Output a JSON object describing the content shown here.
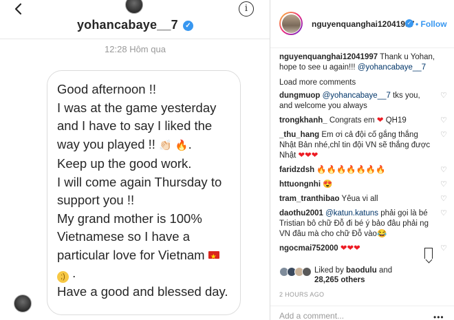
{
  "chat": {
    "username": "yohancabaye__7",
    "timestamp": "12:28 Hôm qua",
    "message": {
      "line1": "Good afternoon !!",
      "line2": "I was at the game yesterday and I have to say I liked the way you played !! ",
      "emoji_clap": "👏🏻",
      "emoji_fire": "🔥",
      "line2_end": ".",
      "line3": "Keep up the good work.",
      "line4": "I will come again Thursday to support you !!",
      "line5": "My grand mother is 100% Vietnamese so I have a particular love for Vietnam ",
      "line5_end": " .",
      "line6": "Have a good and blessed day."
    },
    "icons": {
      "back": "chevron-left-icon",
      "info": "info-icon",
      "verified": "verified-badge-icon"
    }
  },
  "post": {
    "username": "nguyenquanghai12041997",
    "follow_label": "• Follow",
    "caption": {
      "user": "nguyenquanghai12041997",
      "text": " Thank u Yohan, hope to see u again!!! ",
      "mention": "@yohancabaye__7"
    },
    "load_more": "Load more comments",
    "comments": [
      {
        "user": "dungmuop",
        "mention": " @yohancabaye__7",
        "text": " tks you, and welcome you always"
      },
      {
        "user": "trongkhanh_",
        "text": " Congrats em ",
        "hearts": "❤",
        "text2": " QH19"
      },
      {
        "user": "_thu_hang",
        "text": " Em ơi cả đội cố gắng thắng Nhật Bản nhé,chỉ tin đội VN sẽ thắng được Nhật ",
        "hearts": "❤❤❤"
      },
      {
        "user": "faridzdsh",
        "text": " ",
        "fires": "🔥🔥🔥🔥🔥🔥🔥"
      },
      {
        "user": "httuongnhi",
        "text": " ",
        "emoji": "😍"
      },
      {
        "user": "tram_tranthibao",
        "text": " Yêua vi all"
      },
      {
        "user": "daothu2001",
        "mention": " @katun.katuns",
        "text": " phải gọi là bé Tristian bô chữ Đỗ đi bé ý bảo đâu phải ng VN đâu mà cho chữ Đỗ vào",
        "emoji": "😂"
      },
      {
        "user": "ngocmai752000",
        "text": " ",
        "hearts": "❤❤❤"
      }
    ],
    "likes": {
      "liked_by": "Liked by ",
      "user": "baodulu",
      "and": " and",
      "others": "28,265 others"
    },
    "date": "2 HOURS AGO",
    "add_comment_placeholder": "Add a comment...",
    "more": "•••"
  }
}
